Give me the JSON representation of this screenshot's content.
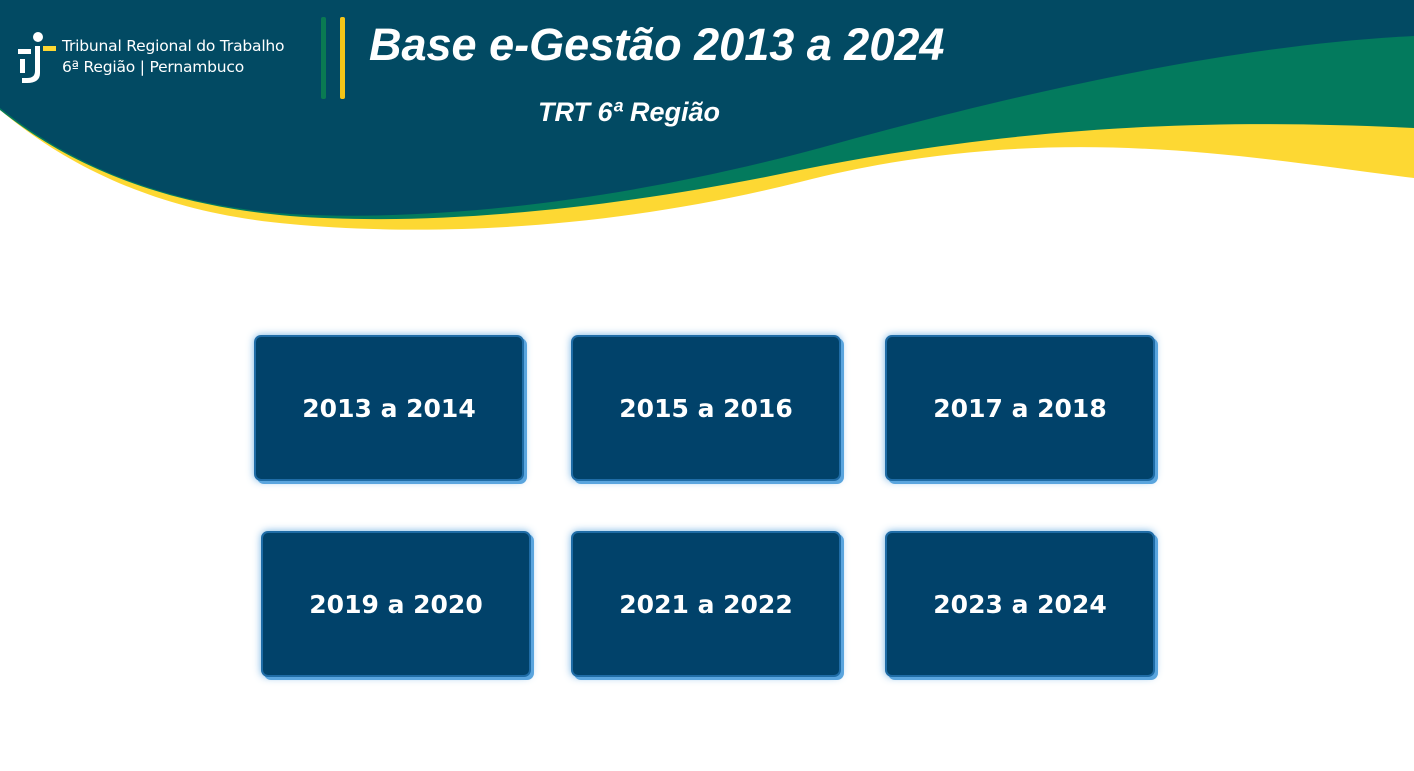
{
  "header": {
    "institution_line1": "Tribunal Regional do Trabalho",
    "institution_line2": "6ª Região | Pernambuco",
    "title": "Base e-Gestão 2013 a 2024",
    "subtitle": "TRT 6ª Região"
  },
  "periods": [
    {
      "label": "2013 a 2014"
    },
    {
      "label": "2015 a 2016"
    },
    {
      "label": "2017 a 2018"
    },
    {
      "label": "2019 a 2020"
    },
    {
      "label": "2021 a 2022"
    },
    {
      "label": "2023 a 2024"
    }
  ],
  "colors": {
    "banner_dark": "#024a63",
    "banner_green": "#037a5d",
    "banner_yellow": "#fdd833",
    "button_fill": "#01426a",
    "button_glow": "#5aa5de"
  },
  "icons": {
    "logo": "trt6-logo-icon"
  }
}
